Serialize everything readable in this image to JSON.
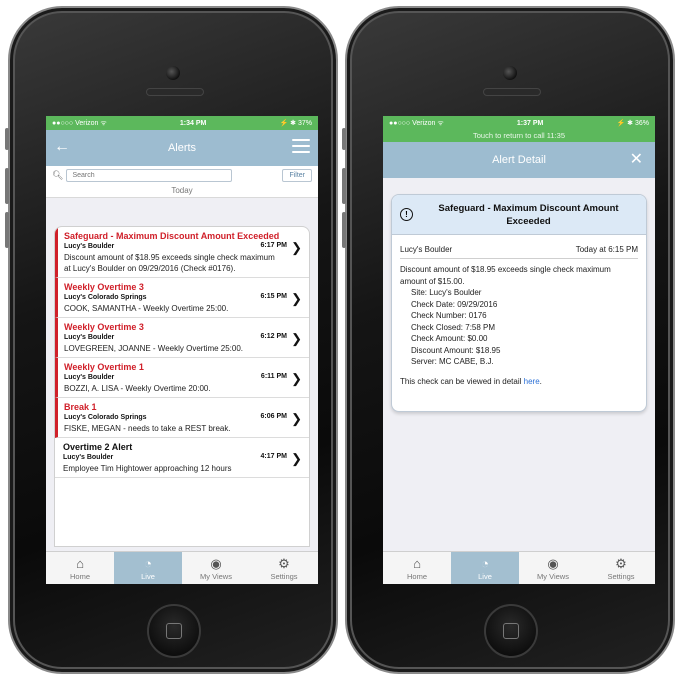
{
  "left": {
    "status": {
      "carrier": "●●○○○ Verizon ᯤ",
      "time": "1:34 PM",
      "right": "⚡ ✱ 37%"
    },
    "nav": {
      "title": "Alerts"
    },
    "search": {
      "placeholder": "Search",
      "filter": "Filter"
    },
    "section": "Today",
    "alerts": [
      {
        "title": "Safeguard - Maximum Discount Amount Exceeded",
        "location": "Lucy's Boulder",
        "time": "6:17 PM",
        "message": "Discount amount of $18.95 exceeds single check maximum at Lucy's Boulder on 09/29/2016 (Check #0176).",
        "color": "red"
      },
      {
        "title": "Weekly Overtime 3",
        "location": "Lucy's Colorado Springs",
        "time": "6:15 PM",
        "message": "COOK, SAMANTHA - Weekly Overtime 25:00.",
        "color": "red"
      },
      {
        "title": "Weekly Overtime 3",
        "location": "Lucy's Boulder",
        "time": "6:12 PM",
        "message": "LOVEGREEN, JOANNE - Weekly Overtime 25:00.",
        "color": "red"
      },
      {
        "title": "Weekly Overtime 1",
        "location": "Lucy's Boulder",
        "time": "6:11 PM",
        "message": "BOZZI, A. LISA - Weekly Overtime 20:00.",
        "color": "red"
      },
      {
        "title": "Break 1",
        "location": "Lucy's Colorado Springs",
        "time": "6:06 PM",
        "message": "FISKE, MEGAN - needs to take a REST break.",
        "color": "red"
      },
      {
        "title": "Overtime 2 Alert",
        "location": "Lucy's Boulder",
        "time": "4:17 PM",
        "message": "Employee Tim Hightower approaching 12 hours",
        "color": "black"
      }
    ]
  },
  "right": {
    "status": {
      "carrier": "●●○○○ Verizon ᯤ",
      "time": "1:37 PM",
      "right": "⚡ ✱ 36%"
    },
    "call_bar": "Touch to return to call 11:35",
    "nav": {
      "title": "Alert Detail"
    },
    "detail": {
      "title": "Safeguard - Maximum Discount Amount Exceeded",
      "location": "Lucy's Boulder",
      "time": "Today at 6:15 PM",
      "summary": "Discount amount of $18.95 exceeds single check maximum amount of $15.00.",
      "fields": [
        "Site: Lucy's Boulder",
        "Check Date: 09/29/2016",
        "Check Number: 0176",
        "Check Closed: 7:58 PM",
        "Check Amount: $0.00",
        "Discount Amount: $18.95",
        "Server: MC CABE, B.J."
      ],
      "footer_pre": "This check can be viewed in detail ",
      "footer_link": "here",
      "footer_post": "."
    }
  },
  "tabs": [
    {
      "label": "Home",
      "icon": "home-icon"
    },
    {
      "label": "Live",
      "icon": "speedometer-icon"
    },
    {
      "label": "My Views",
      "icon": "eye-icon"
    },
    {
      "label": "Settings",
      "icon": "gear-icon"
    }
  ],
  "colors": {
    "status_green": "#5cb85c",
    "nav_blue": "#9dbcd0",
    "alert_red": "#d0202a"
  }
}
